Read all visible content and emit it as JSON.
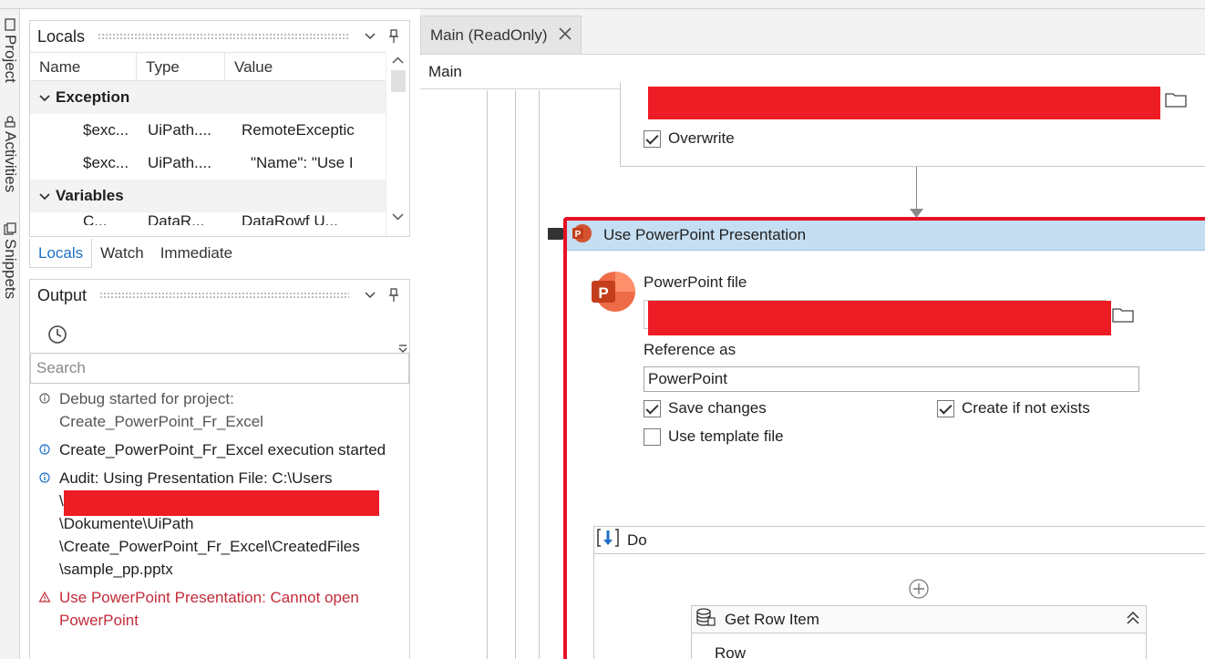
{
  "dock": {
    "tabs": [
      {
        "label": "Project",
        "icon": "page-icon"
      },
      {
        "label": "Activities",
        "icon": "activities-icon"
      },
      {
        "label": "Snippets",
        "icon": "snippets-icon"
      }
    ]
  },
  "locals_panel": {
    "title": "Locals",
    "columns": [
      "Name",
      "Type",
      "Value"
    ],
    "groups": [
      {
        "label": "Exception",
        "rows": [
          {
            "name": "$exc...",
            "type": "UiPath....",
            "value": "RemoteExceptic"
          },
          {
            "name": "$exc...",
            "type": "UiPath....",
            "value": "\"Name\": \"Use I"
          }
        ]
      },
      {
        "label": "Variables",
        "rows": []
      }
    ],
    "partial_row": {
      "name": "C...",
      "type": "DataR...",
      "value": "DataRowf U..."
    }
  },
  "bottom_tabs": [
    {
      "label": "Locals",
      "active": true
    },
    {
      "label": "Watch",
      "active": false
    },
    {
      "label": "Immediate",
      "active": false
    }
  ],
  "output_panel": {
    "title": "Output",
    "search_placeholder": "Search",
    "messages": [
      {
        "kind": "info",
        "lines": [
          "Debug started for project:",
          "Create_PowerPoint_Fr_Excel"
        ],
        "muted": true
      },
      {
        "kind": "info",
        "lines": [
          "Create_PowerPoint_Fr_Excel execution started"
        ],
        "muted": false
      },
      {
        "kind": "info",
        "lines": [
          "Audit: Using Presentation File: C:\\Users",
          "\\",
          "\\Dokumente\\UiPath",
          "\\Create_PowerPoint_Fr_Excel\\CreatedFiles",
          "\\sample_pp.pptx"
        ],
        "muted": false
      },
      {
        "kind": "error",
        "lines": [
          "Use PowerPoint Presentation: Cannot open",
          "PowerPoint"
        ],
        "muted": false
      }
    ]
  },
  "designer": {
    "doc_tab": "Main (ReadOnly)",
    "breadcrumb": "Main",
    "overwrite_label": "Overwrite",
    "overwrite_checked": true,
    "ppt_activity": {
      "title": "Use PowerPoint Presentation",
      "file_label": "PowerPoint file",
      "reference_label": "Reference as",
      "reference_value": "PowerPoint",
      "save_changes_label": "Save changes",
      "save_changes_checked": true,
      "create_if_not_exists_label": "Create if not exists",
      "create_if_not_exists_checked": true,
      "use_template_label": "Use template file",
      "use_template_checked": false
    },
    "do_label": "Do",
    "get_row_item": {
      "title": "Get Row Item",
      "row_label": "Row"
    }
  },
  "colors": {
    "redaction": "#ee1c25",
    "selected_border": "#e81123",
    "activity_header": "#c5def1",
    "link_blue": "#1e6fc4",
    "error_red": "#c42b3a"
  }
}
